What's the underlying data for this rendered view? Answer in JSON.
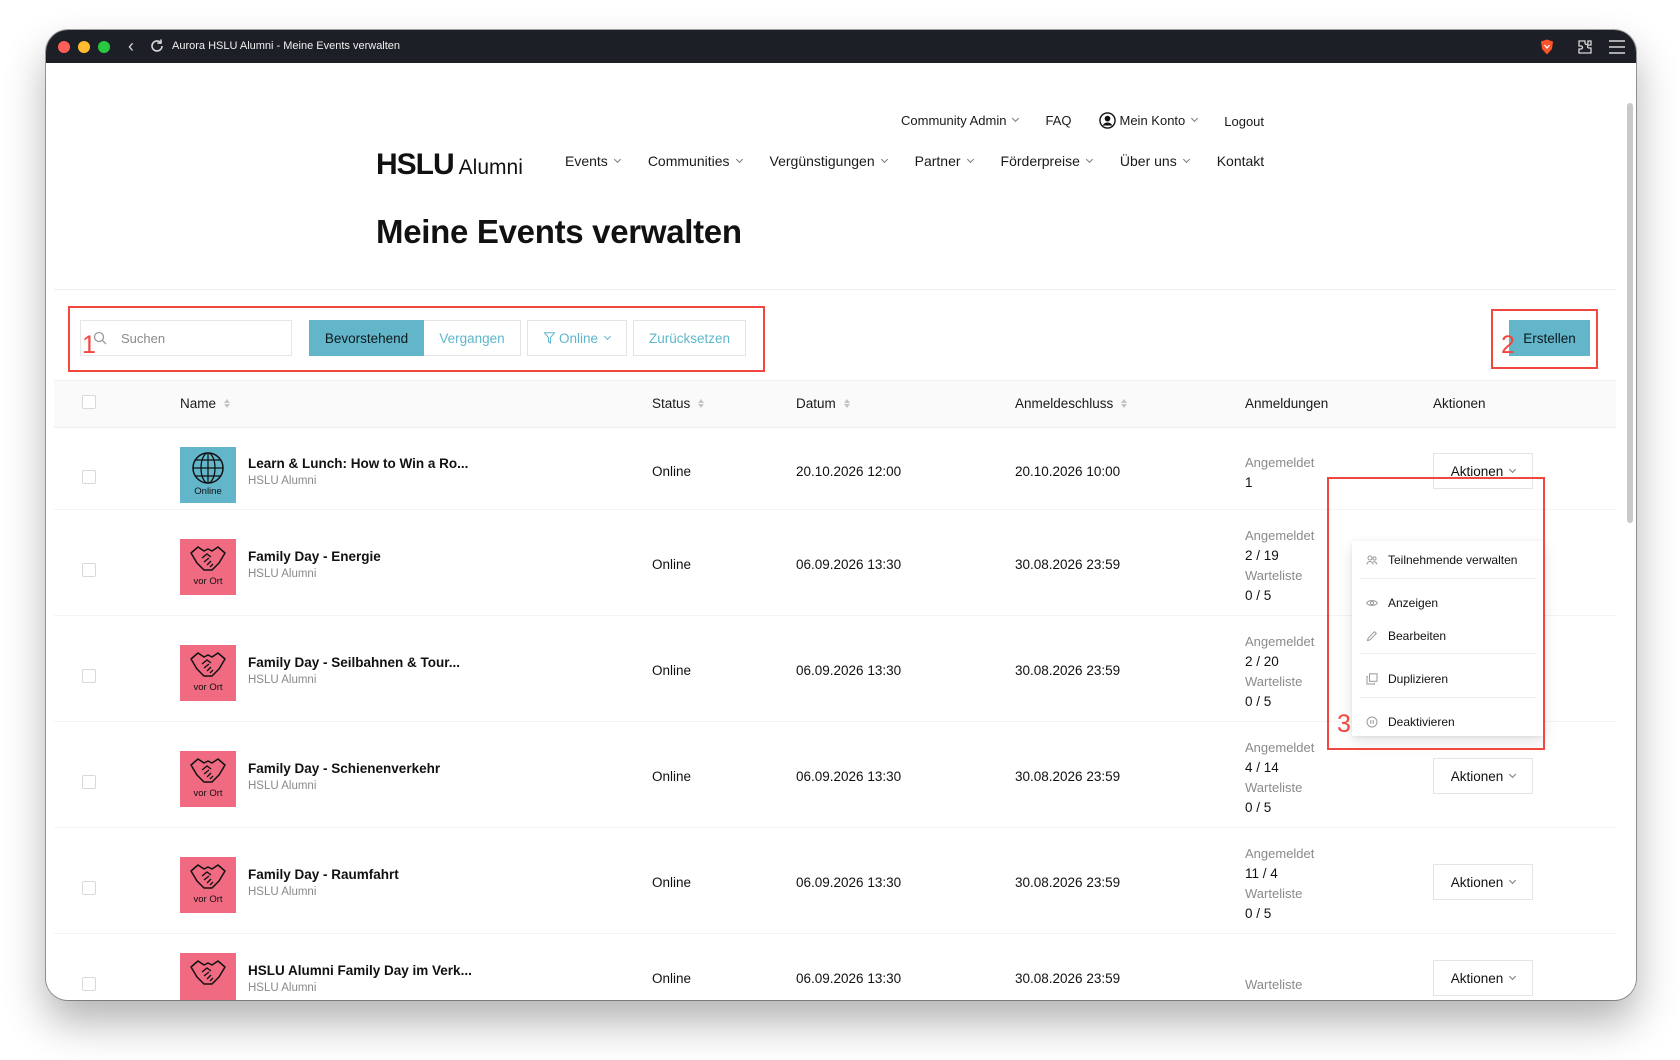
{
  "browser": {
    "title": "Aurora HSLU Alumni - Meine Events verwalten"
  },
  "topnav": {
    "community_admin": "Community Admin",
    "faq": "FAQ",
    "account": "Mein Konto",
    "logout": "Logout"
  },
  "logo": {
    "main": "HSLU",
    "sub": "Alumni"
  },
  "mainnav": {
    "events": "Events",
    "communities": "Communities",
    "perks": "Vergünstigungen",
    "partner": "Partner",
    "awards": "Förderpreise",
    "about": "Über uns",
    "contact": "Kontakt"
  },
  "page": {
    "title": "Meine Events verwalten"
  },
  "toolbar": {
    "search_placeholder": "Suchen",
    "upcoming": "Bevorstehend",
    "past": "Vergangen",
    "online_filter": "Online",
    "reset": "Zurücksetzen",
    "create": "Erstellen"
  },
  "annotations": {
    "one": "1",
    "two": "2",
    "three": "3"
  },
  "colors": {
    "accent": "#63b5c9",
    "vor_ort": "#f06a82",
    "annotation": "#f2473f"
  },
  "table": {
    "headers": {
      "name": "Name",
      "status": "Status",
      "date": "Datum",
      "deadline": "Anmeldeschluss",
      "registrations": "Anmeldungen",
      "actions": "Aktionen"
    },
    "labels": {
      "registered": "Angemeldet",
      "waitlist": "Warteliste",
      "actions_button": "Aktionen"
    },
    "rows": [
      {
        "thumb": "Online",
        "name": "Learn & Lunch: How to Win a Ro...",
        "org": "HSLU Alumni",
        "status": "Online",
        "date": "20.10.2026 12:00",
        "deadline": "20.10.2026 10:00",
        "registered": "1"
      },
      {
        "thumb": "vor Ort",
        "name": "Family Day - Energie",
        "org": "HSLU Alumni",
        "status": "Online",
        "date": "06.09.2026 13:30",
        "deadline": "30.08.2026 23:59",
        "registered": "2 / 19",
        "waitlist": "0 / 5"
      },
      {
        "thumb": "vor Ort",
        "name": "Family Day - Seilbahnen & Tour...",
        "org": "HSLU Alumni",
        "status": "Online",
        "date": "06.09.2026 13:30",
        "deadline": "30.08.2026 23:59",
        "registered": "2 / 20",
        "waitlist": "0 / 5"
      },
      {
        "thumb": "vor Ort",
        "name": "Family Day - Schienenverkehr",
        "org": "HSLU Alumni",
        "status": "Online",
        "date": "06.09.2026 13:30",
        "deadline": "30.08.2026 23:59",
        "registered": "4 / 14",
        "waitlist": "0 / 5"
      },
      {
        "thumb": "vor Ort",
        "name": "Family Day - Raumfahrt",
        "org": "HSLU Alumni",
        "status": "Online",
        "date": "06.09.2026 13:30",
        "deadline": "30.08.2026 23:59",
        "registered": "11 / 4",
        "waitlist": "0 / 5"
      },
      {
        "thumb": "vor Ort",
        "name": "HSLU Alumni Family Day im Verk...",
        "org": "HSLU Alumni",
        "status": "Online",
        "date": "06.09.2026 13:30",
        "deadline": "30.08.2026 23:59"
      }
    ]
  },
  "dropdown": {
    "manage": "Teilnehmende verwalten",
    "view": "Anzeigen",
    "edit": "Bearbeiten",
    "duplicate": "Duplizieren",
    "deactivate": "Deaktivieren"
  }
}
